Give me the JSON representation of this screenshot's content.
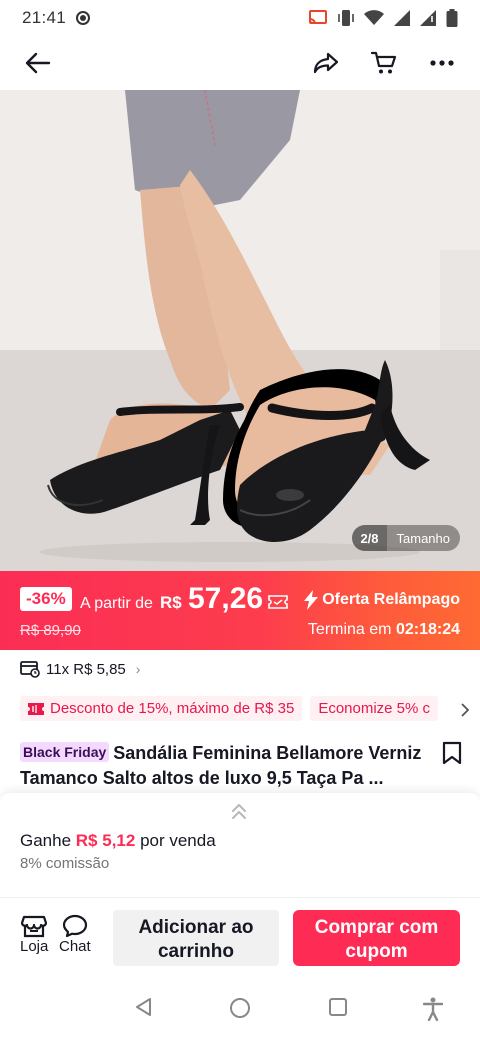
{
  "status": {
    "time": "21:41"
  },
  "nav": {
    "back_icon": "arrow-left-icon",
    "share_icon": "share-icon",
    "cart_icon": "cart-icon",
    "more_icon": "more-icon"
  },
  "gallery": {
    "counter": "2/8",
    "tag": "Tamanho"
  },
  "price_banner": {
    "discount": "-36%",
    "from_label": "A partir de",
    "currency": "R$",
    "price": "57,26",
    "old_price": "R$ 89,90",
    "flash_label": "Oferta Relâmpago",
    "ends_label": "Termina em",
    "countdown": "02:18:24",
    "colors": {
      "start": "#fb2d55",
      "end": "#ff6a33"
    }
  },
  "installments": {
    "text": "11x R$ 5,85",
    "chevron": "›"
  },
  "coupons": [
    {
      "label": "Desconto de 15%, máximo de R$ 35"
    },
    {
      "label": "Economize 5% c"
    }
  ],
  "product": {
    "badge": "Black Friday",
    "title": "Sandália Feminina Bellamore Verniz Tamanco Salto altos de luxo 9,5 Taça Pa ..."
  },
  "commission": {
    "earn_prefix": "Ganhe",
    "earn_amount": "R$ 5,12",
    "earn_suffix": "por venda",
    "rate": "8% comissão"
  },
  "actions": {
    "shop_label": "Loja",
    "chat_label": "Chat",
    "add_to_cart": "Adicionar ao carrinho",
    "buy_with_coupon": "Comprar com cupom"
  },
  "accent": "#fe2c55"
}
